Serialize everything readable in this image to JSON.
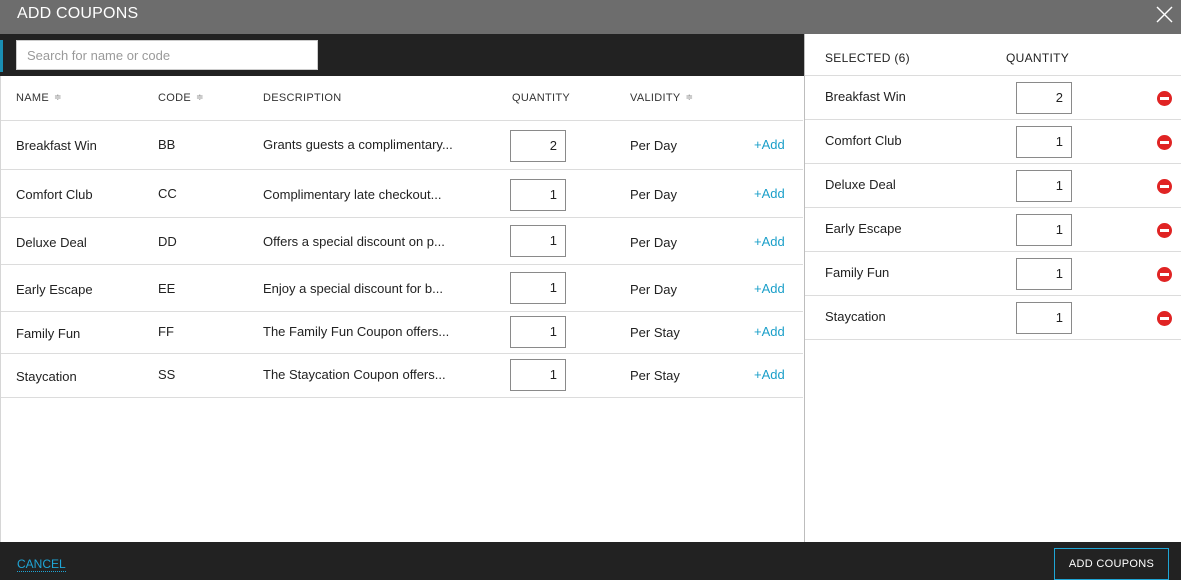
{
  "dialog": {
    "title": "ADD COUPONS",
    "close_icon": "close-icon"
  },
  "search": {
    "placeholder": "Search for name or code",
    "value": ""
  },
  "table": {
    "headers": {
      "name": "NAME",
      "code": "CODE",
      "description": "DESCRIPTION",
      "quantity": "QUANTITY",
      "validity": "VALIDITY"
    },
    "sortable_icon": "sort-arrows-icon",
    "add_label": "+Add",
    "rows": [
      {
        "name": "Breakfast Win",
        "code": "BB",
        "description": "Grants guests a complimentary...",
        "quantity": "2",
        "validity": "Per Day"
      },
      {
        "name": "Comfort Club",
        "code": "CC",
        "description": "Complimentary late checkout...",
        "quantity": "1",
        "validity": "Per Day"
      },
      {
        "name": "Deluxe Deal",
        "code": "DD",
        "description": "Offers a special discount on p...",
        "quantity": "1",
        "validity": "Per Day"
      },
      {
        "name": "Early Escape",
        "code": "EE",
        "description": "Enjoy a special discount for b...",
        "quantity": "1",
        "validity": "Per Day"
      },
      {
        "name": "Family Fun",
        "code": "FF",
        "description": "The Family Fun Coupon offers...",
        "quantity": "1",
        "validity": "Per Stay"
      },
      {
        "name": "Staycation",
        "code": "SS",
        "description": "The Staycation Coupon offers...",
        "quantity": "1",
        "validity": "Per Stay"
      }
    ]
  },
  "selected": {
    "header": "SELECTED (6)",
    "quantity_header": "QUANTITY",
    "remove_icon": "remove-circle-icon",
    "items": [
      {
        "name": "Breakfast Win",
        "quantity": "2"
      },
      {
        "name": "Comfort Club",
        "quantity": "1"
      },
      {
        "name": "Deluxe Deal",
        "quantity": "1"
      },
      {
        "name": "Early Escape",
        "quantity": "1"
      },
      {
        "name": "Family Fun",
        "quantity": "1"
      },
      {
        "name": "Staycation",
        "quantity": "1"
      }
    ]
  },
  "footer": {
    "cancel_label": "CANCEL",
    "add_coupons_label": "ADD COUPONS"
  },
  "colors": {
    "accent": "#1fa6d6",
    "remove": "#e02424",
    "titlebar": "#6d6d6d",
    "dark_bar": "#222222"
  }
}
